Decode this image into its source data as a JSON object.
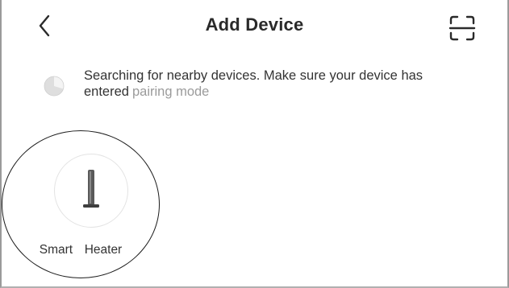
{
  "header": {
    "title": "Add Device",
    "back_icon": "chevron-left-icon",
    "scan_icon": "scan-frame-icon"
  },
  "search": {
    "status_text": "Searching for nearby devices. Make sure your device has entered",
    "link_text": "pairing mode",
    "spinner_icon": "loading-spinner-icon"
  },
  "devices": [
    {
      "label": "Smart  Heater",
      "icon": "tower-heater-icon"
    }
  ],
  "colors": {
    "text_primary": "#2a2a2a",
    "text_muted": "#9b9b9b",
    "background": "#ffffff"
  }
}
